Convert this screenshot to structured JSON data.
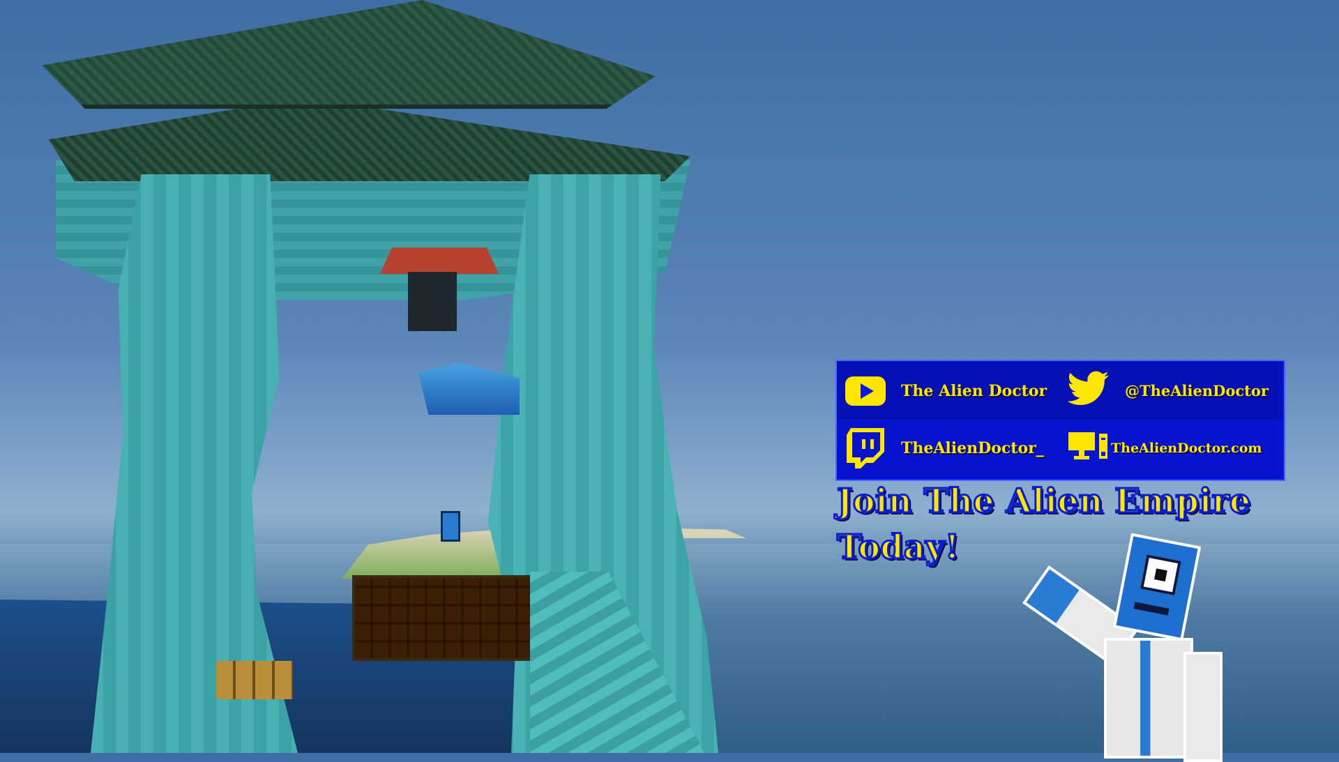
{
  "social": {
    "youtube": {
      "icon": "youtube-icon",
      "label": "The Alien Doctor"
    },
    "twitter": {
      "icon": "twitter-icon",
      "label": "@TheAlienDoctor"
    },
    "twitch": {
      "icon": "twitch-icon",
      "label": "TheAlienDoctor_"
    },
    "website": {
      "icon": "computer-icon",
      "label": "TheAlienDoctor.com"
    }
  },
  "cta": {
    "line1": "Join The Alien Empire",
    "line2": "Today!"
  },
  "colors": {
    "panel": "#0717e6",
    "text": "#ffe600",
    "outline": "#0a1ecc"
  }
}
